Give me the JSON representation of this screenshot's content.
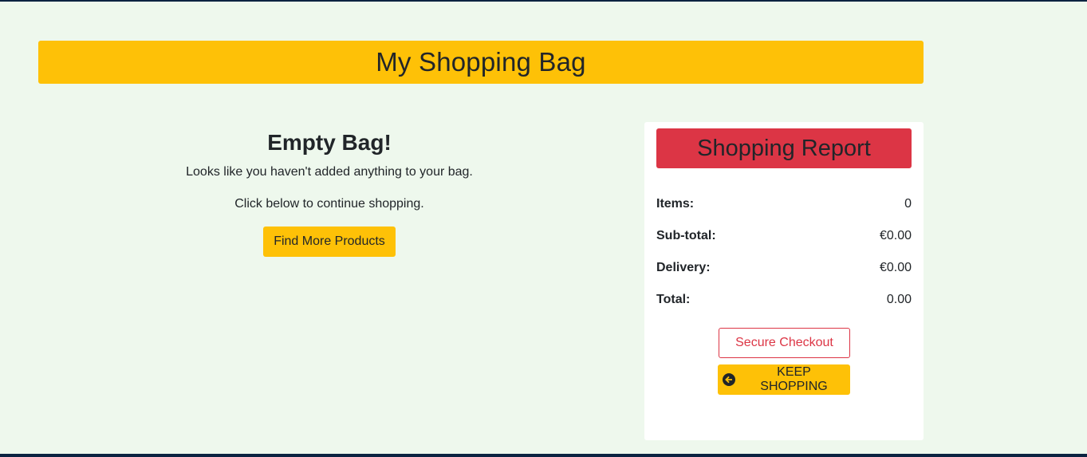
{
  "page": {
    "title": "My Shopping Bag"
  },
  "empty_bag": {
    "heading": "Empty Bag!",
    "message": "Looks like you haven't added anything to your bag.",
    "prompt": "Click below to continue shopping.",
    "button_label": "Find More Products"
  },
  "report": {
    "title": "Shopping Report",
    "rows": [
      {
        "label": "Items:",
        "value": "0"
      },
      {
        "label": "Sub-total:",
        "value": "€0.00"
      },
      {
        "label": "Delivery:",
        "value": "€0.00"
      },
      {
        "label": "Total:",
        "value": "0.00"
      }
    ],
    "checkout_label": "Secure Checkout",
    "keep_shopping_label": "KEEP SHOPPING",
    "keep_shopping_icon": "arrow-circle-left-icon"
  },
  "colors": {
    "background": "#eef8ed",
    "accent_yellow": "#fec107",
    "accent_red": "#dc3545",
    "border_navy": "#0b2341"
  }
}
